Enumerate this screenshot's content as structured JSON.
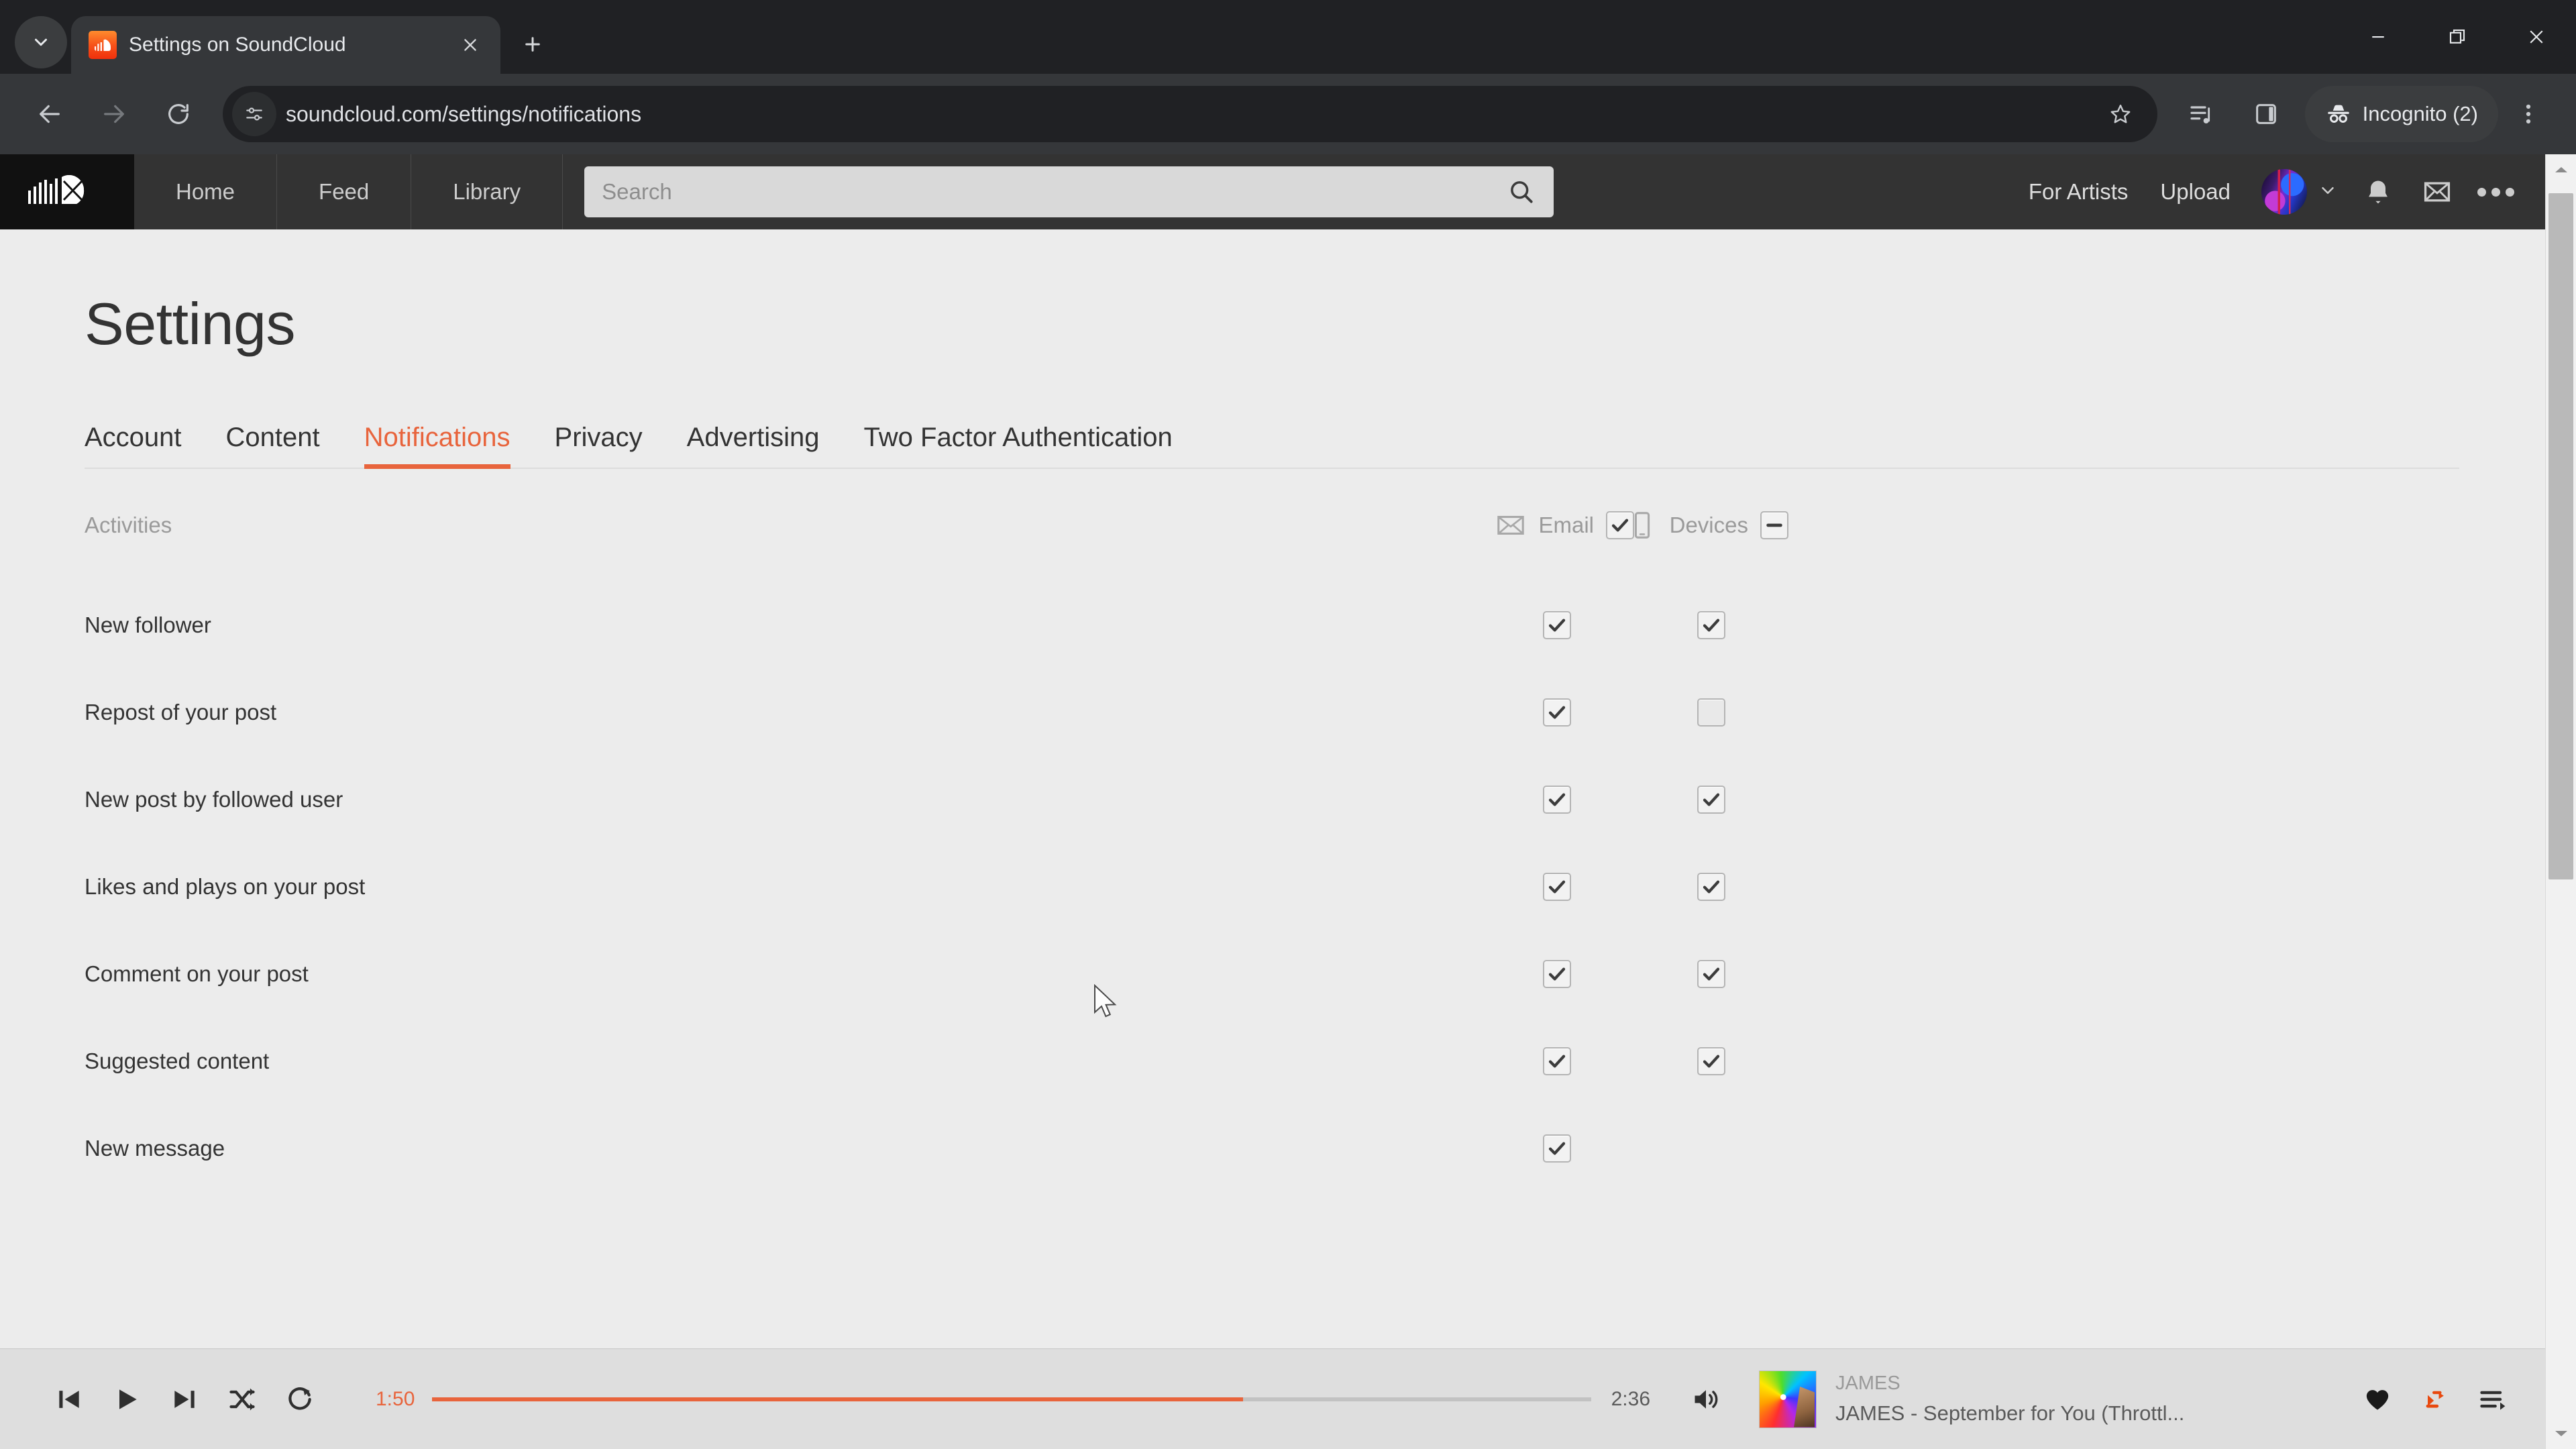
{
  "browser": {
    "tab": {
      "title": "Settings on SoundCloud",
      "favicon": "soundcloud-favicon"
    },
    "new_tab_label": "+",
    "omnibox": {
      "url": "soundcloud.com/settings/notifications",
      "site_info_icon": "tune-icon",
      "bookmark_icon": "star-icon"
    },
    "profile_pill": {
      "label": "Incognito (2)",
      "icon": "incognito-icon"
    },
    "window_controls": {
      "minimize": "minimize-icon",
      "maximize": "restore-icon",
      "close": "close-icon"
    }
  },
  "site_header": {
    "logo": "soundcloud-logo",
    "nav": [
      {
        "label": "Home"
      },
      {
        "label": "Feed"
      },
      {
        "label": "Library"
      }
    ],
    "search": {
      "placeholder": "Search",
      "value": "",
      "icon": "search-icon"
    },
    "links": [
      {
        "label": "For Artists"
      },
      {
        "label": "Upload"
      }
    ],
    "avatar": "user-avatar",
    "icons": [
      "chevron-down-icon",
      "bell-icon",
      "mail-icon",
      "more-icon"
    ]
  },
  "page": {
    "title": "Settings",
    "tabs": [
      {
        "label": "Account",
        "active": false
      },
      {
        "label": "Content",
        "active": false
      },
      {
        "label": "Notifications",
        "active": true
      },
      {
        "label": "Privacy",
        "active": false
      },
      {
        "label": "Advertising",
        "active": false
      },
      {
        "label": "Two Factor Authentication",
        "active": false
      }
    ],
    "section": {
      "title": "Activities",
      "columns": [
        {
          "label": "Email",
          "icon": "envelope-icon",
          "state": "checked"
        },
        {
          "label": "Devices",
          "icon": "phone-icon",
          "state": "indeterminate"
        }
      ],
      "rows": [
        {
          "label": "New follower",
          "email": "checked",
          "devices": "checked"
        },
        {
          "label": "Repost of your post",
          "email": "checked",
          "devices": "unchecked"
        },
        {
          "label": "New post by followed user",
          "email": "checked",
          "devices": "checked"
        },
        {
          "label": "Likes and plays on your post",
          "email": "checked",
          "devices": "checked"
        },
        {
          "label": "Comment on your post",
          "email": "checked",
          "devices": "checked"
        },
        {
          "label": "Suggested content",
          "email": "checked",
          "devices": "checked"
        },
        {
          "label": "New message",
          "email": "checked",
          "devices": "none"
        }
      ]
    }
  },
  "player": {
    "controls": [
      "skip-back-icon",
      "play-icon",
      "skip-forward-icon",
      "shuffle-icon",
      "repeat-icon"
    ],
    "elapsed": "1:50",
    "duration": "2:36",
    "progress_percent": 70,
    "progress_color": "#e8643c",
    "volume_icon": "volume-icon",
    "artwork": "album-artwork",
    "artist": "JAMES",
    "title": "JAMES - September for You (Throttl...",
    "actions": [
      "heart-icon",
      "repost-icon",
      "playlist-icon"
    ]
  },
  "scrollbar": {
    "up_arrow": "caret-up-icon",
    "down_arrow": "caret-down-icon",
    "thumb_top_percent": 3,
    "thumb_height_percent": 53
  }
}
